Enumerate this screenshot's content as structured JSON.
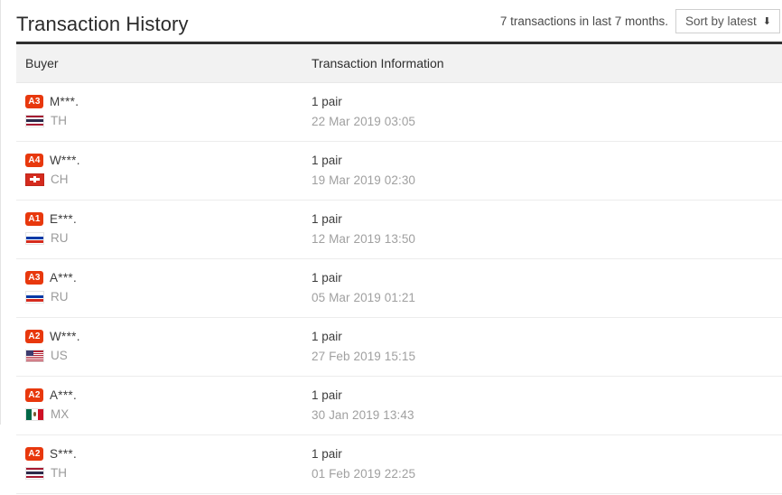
{
  "header": {
    "title": "Transaction History",
    "transaction_count_text": "7 transactions in last 7 months.",
    "sort_label": "Sort by latest",
    "sort_caret": "⬇"
  },
  "table": {
    "columns": {
      "buyer": "Buyer",
      "info": "Transaction Information"
    },
    "rows": [
      {
        "rating": "A3",
        "buyer": "M***.",
        "country_code": "TH",
        "country_flag": "th-flag-icon",
        "quantity": "1 pair",
        "datetime": "22 Mar 2019 03:05"
      },
      {
        "rating": "A4",
        "buyer": "W***.",
        "country_code": "CH",
        "country_flag": "ch-flag-icon",
        "quantity": "1 pair",
        "datetime": "19 Mar 2019 02:30"
      },
      {
        "rating": "A1",
        "buyer": "E***.",
        "country_code": "RU",
        "country_flag": "ru-flag-icon",
        "quantity": "1 pair",
        "datetime": "12 Mar 2019 13:50"
      },
      {
        "rating": "A3",
        "buyer": "A***.",
        "country_code": "RU",
        "country_flag": "ru-flag-icon",
        "quantity": "1 pair",
        "datetime": "05 Mar 2019 01:21"
      },
      {
        "rating": "A2",
        "buyer": "W***.",
        "country_code": "US",
        "country_flag": "us-flag-icon",
        "quantity": "1 pair",
        "datetime": "27 Feb 2019 15:15"
      },
      {
        "rating": "A2",
        "buyer": "A***.",
        "country_code": "MX",
        "country_flag": "mx-flag-icon",
        "quantity": "1 pair",
        "datetime": "30 Jan 2019 13:43"
      },
      {
        "rating": "A2",
        "buyer": "S***.",
        "country_code": "TH",
        "country_flag": "th-flag-icon",
        "quantity": "1 pair",
        "datetime": "01 Feb 2019 22:25"
      }
    ]
  },
  "colors": {
    "rating_badge": "#e8380d",
    "header_rule": "#2f2f2f",
    "column_header_bg": "#f2f2f2",
    "muted_text": "#a0a0a0"
  }
}
